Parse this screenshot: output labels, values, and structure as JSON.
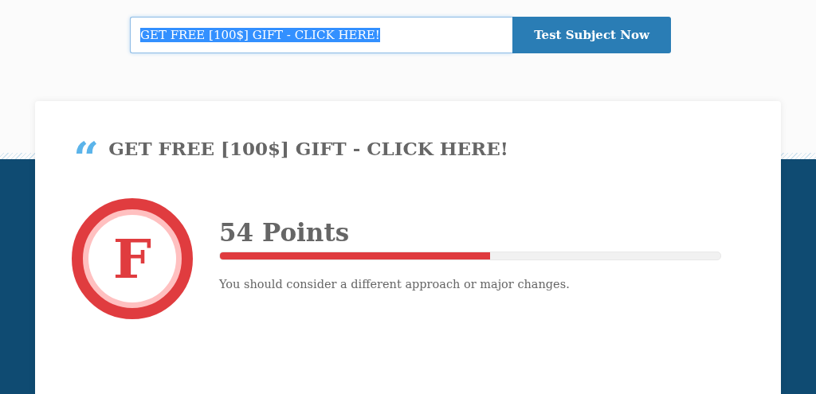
{
  "search": {
    "value": "GET FREE [100$] GIFT - CLICK HERE!",
    "text_selected": true,
    "button": "Test Subject Now"
  },
  "result": {
    "quote_mark": "“",
    "subject": "GET FREE [100$] GIFT - CLICK HERE!",
    "grade": "F",
    "points": "54 Points",
    "level": 0.54,
    "message": "You should consider a different approach or major changes."
  }
}
